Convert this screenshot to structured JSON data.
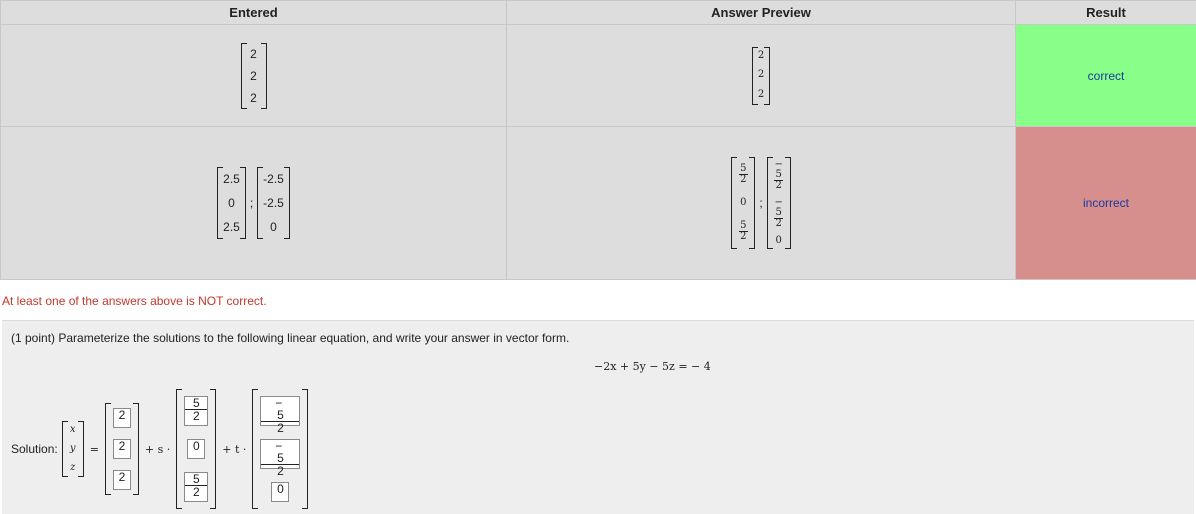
{
  "table": {
    "headers": {
      "entered": "Entered",
      "preview": "Answer Preview",
      "result": "Result"
    },
    "rows": [
      {
        "entered": [
          [
            "2",
            "2",
            "2"
          ]
        ],
        "preview": [
          [
            "2",
            "2",
            "2"
          ]
        ],
        "result": "correct",
        "result_color": "#88ff88"
      },
      {
        "entered": [
          [
            "2.5",
            "0",
            "2.5"
          ],
          [
            "-2.5",
            "-2.5",
            "0"
          ]
        ],
        "separator": ";",
        "preview": [
          [
            "5/2",
            "0",
            "5/2"
          ],
          [
            "-5/2",
            "-5/2",
            "0"
          ]
        ],
        "result": "incorrect",
        "result_color": "#d68f8c"
      }
    ]
  },
  "message": "At least one of the answers above is NOT correct.",
  "problem": {
    "prompt": "(1 point) Parameterize the solutions to the following linear equation, and write your answer in vector form.",
    "equation": "−2x + 5y − 5z = − 4",
    "solution_label": "Solution:",
    "variables": [
      "x",
      "y",
      "z"
    ],
    "equals": "=",
    "plus_s": "+ s ·",
    "plus_t": "+ t ·",
    "answers": {
      "constant": [
        "2",
        "2",
        "2"
      ],
      "s_vector": [
        "5/2",
        "0",
        "5/2"
      ],
      "t_vector": [
        "-5/2",
        "-5/2",
        "0"
      ]
    }
  }
}
